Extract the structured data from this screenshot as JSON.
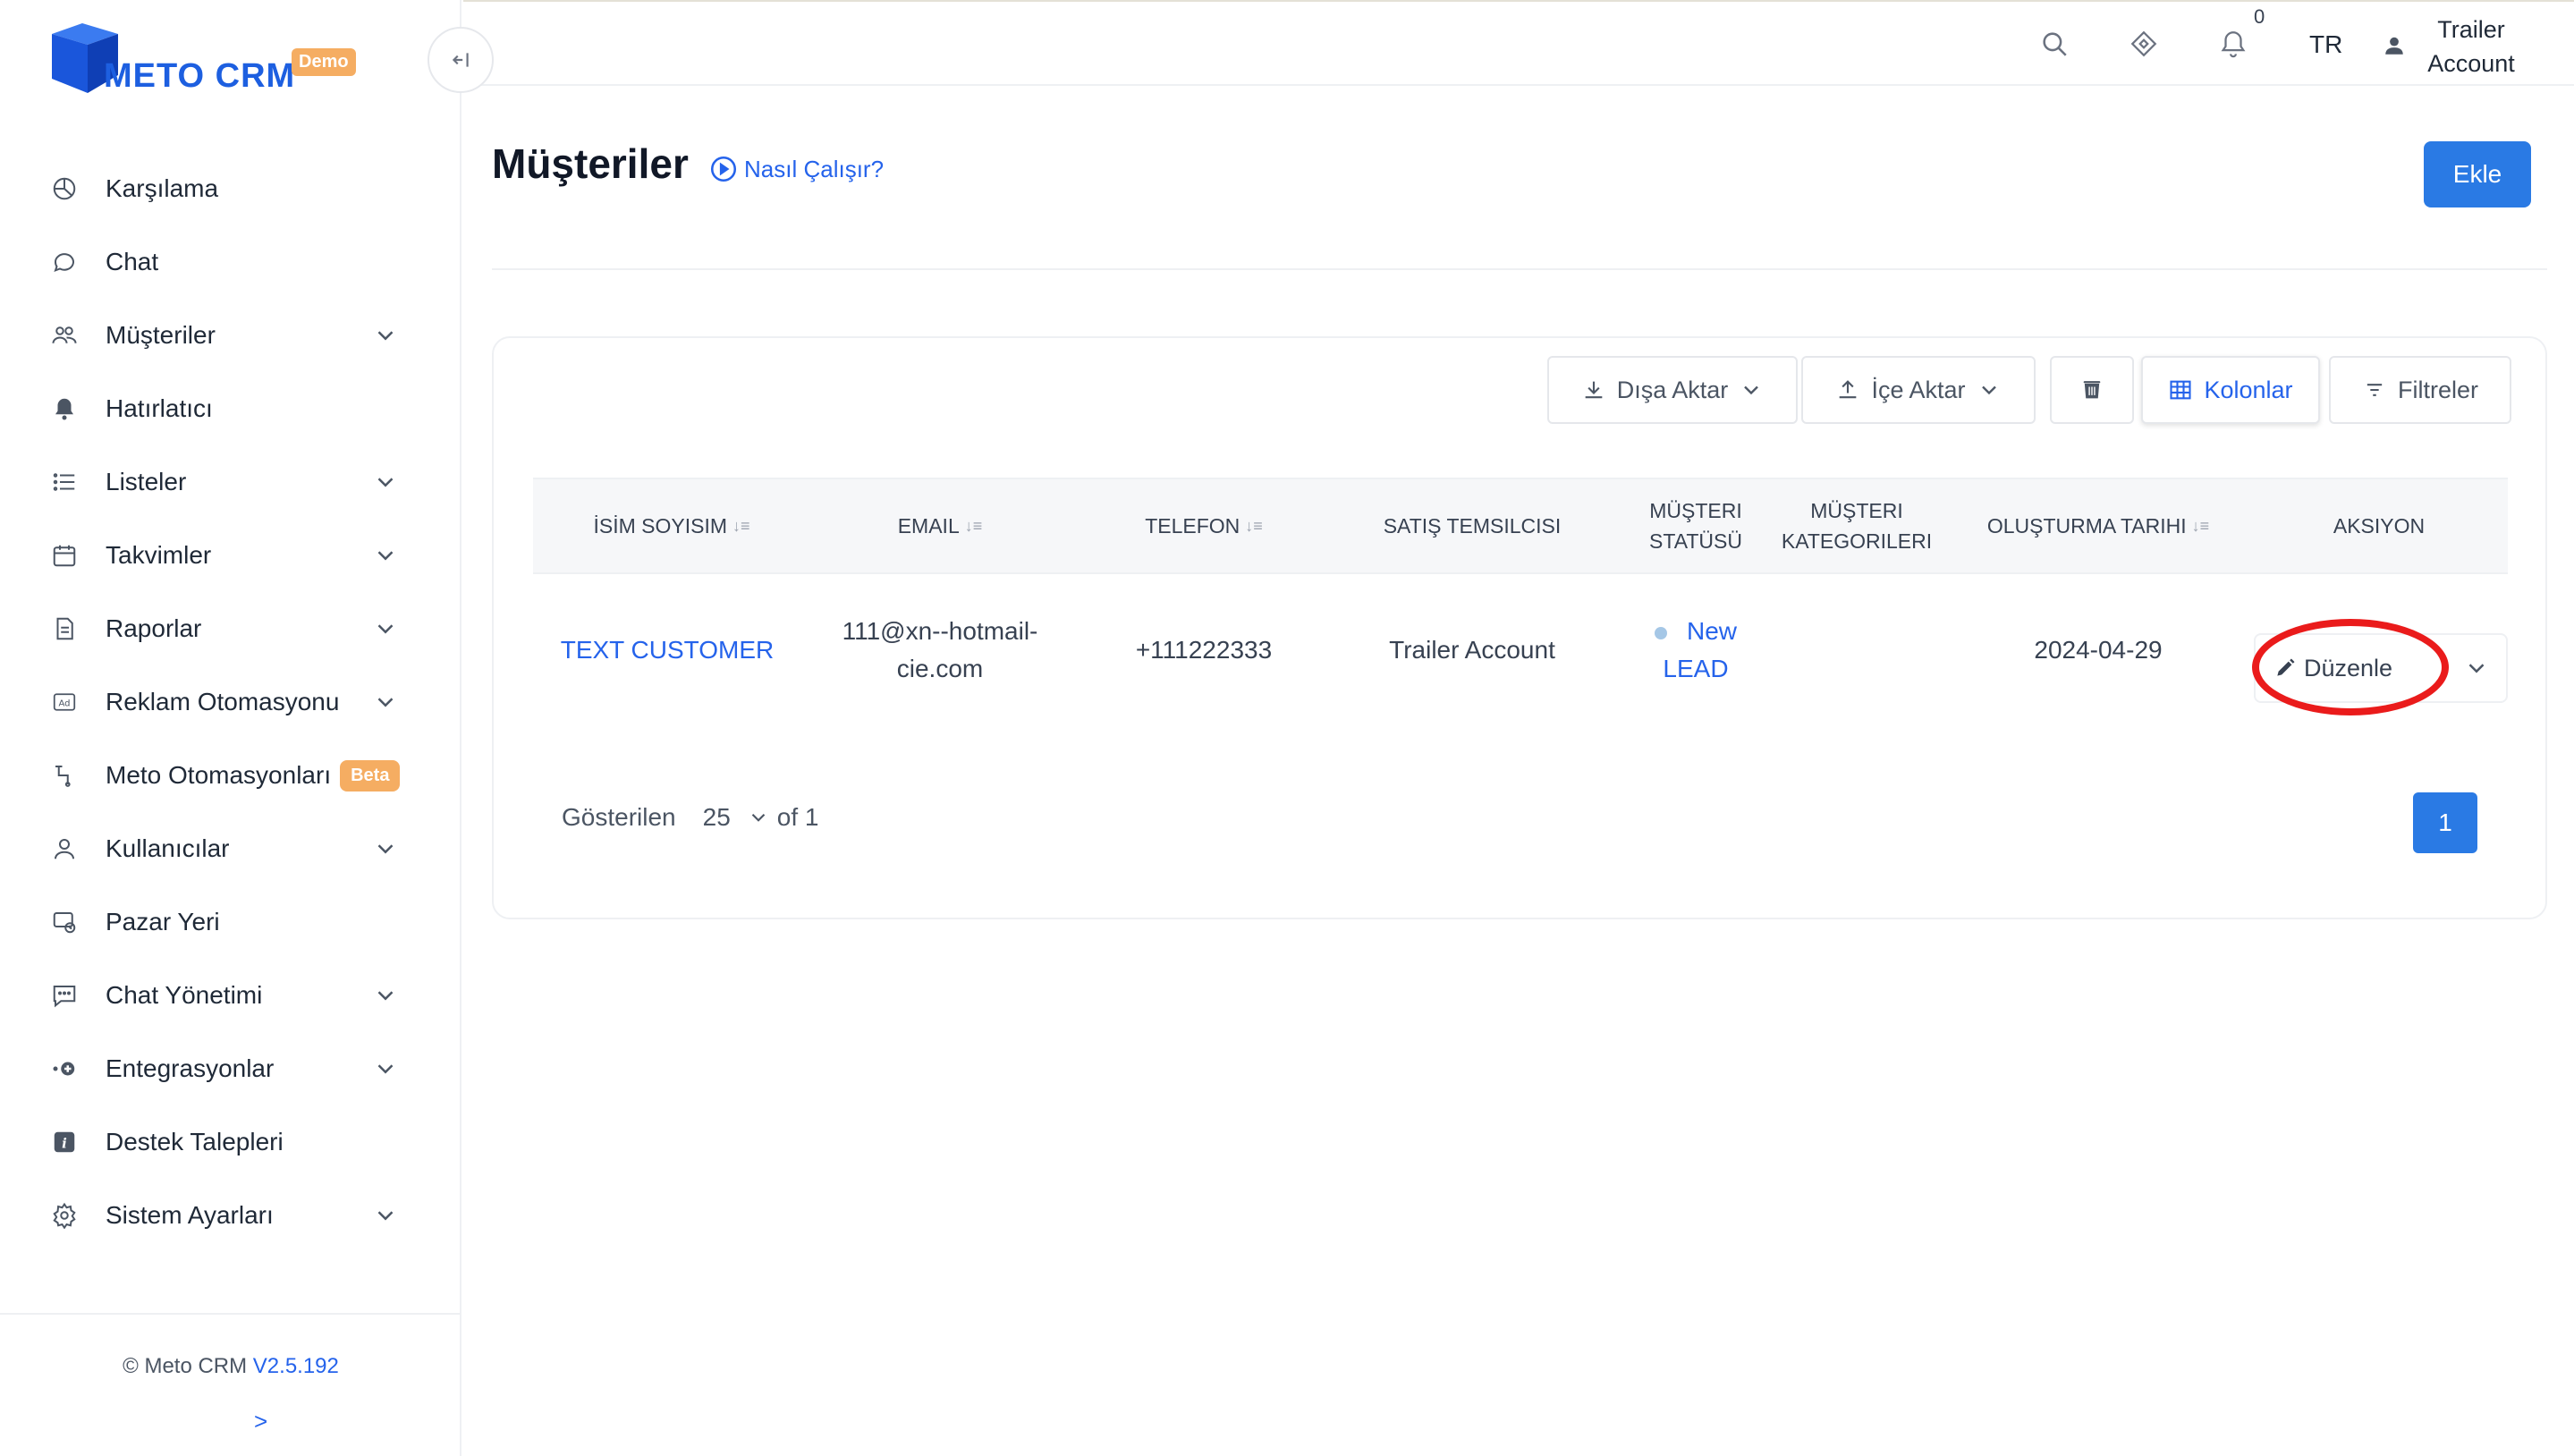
{
  "brand": {
    "name": "METO CRM",
    "badge": "Demo"
  },
  "sidebar": {
    "items": [
      {
        "label": "Karşılama",
        "icon": "dashboard-icon",
        "chevron": false
      },
      {
        "label": "Chat",
        "icon": "chat-icon",
        "chevron": false
      },
      {
        "label": "Müşteriler",
        "icon": "users-icon",
        "chevron": true
      },
      {
        "label": "Hatırlatıcı",
        "icon": "bell-icon",
        "chevron": false
      },
      {
        "label": "Listeler",
        "icon": "list-icon",
        "chevron": true
      },
      {
        "label": "Takvimler",
        "icon": "calendar-icon",
        "chevron": true
      },
      {
        "label": "Raporlar",
        "icon": "report-icon",
        "chevron": true
      },
      {
        "label": "Reklam Otomasyonu",
        "icon": "ad-icon",
        "chevron": true
      },
      {
        "label": "Meto Otomasyonları",
        "icon": "automation-icon",
        "chevron": false,
        "badge": "Beta"
      },
      {
        "label": "Kullanıcılar",
        "icon": "user-icon",
        "chevron": true
      },
      {
        "label": "Pazar Yeri",
        "icon": "marketplace-icon",
        "chevron": false
      },
      {
        "label": "Chat Yönetimi",
        "icon": "chat-settings-icon",
        "chevron": true
      },
      {
        "label": "Entegrasyonlar",
        "icon": "integration-icon",
        "chevron": true
      },
      {
        "label": "Destek Talepleri",
        "icon": "info-icon",
        "chevron": false
      },
      {
        "label": "Sistem Ayarları",
        "icon": "gear-icon",
        "chevron": true
      }
    ],
    "footer": {
      "copyright": "© Meto CRM",
      "version": "V2.5.192",
      "arrow": ">"
    }
  },
  "topbar": {
    "notification_count": "0",
    "language": "TR",
    "user": "Trailer Account"
  },
  "page": {
    "title": "Müşteriler",
    "howto": "Nasıl Çalışır?",
    "add_button": "Ekle"
  },
  "toolbar": {
    "export": "Dışa Aktar",
    "import": "İçe Aktar",
    "columns": "Kolonlar",
    "filters": "Filtreler"
  },
  "table": {
    "headers": [
      "İSİM SOYISIM",
      "EMAIL",
      "TELEFON",
      "SATIŞ TEMSILCISI",
      "MÜŞTERI STATÜSÜ",
      "MÜŞTERI KATEGORILERI",
      "OLUŞTURMA TARIHI",
      "AKSIYON"
    ],
    "rows": [
      {
        "name": "TEXT CUSTOMER",
        "email": "111@xn--hotmail-cie.com",
        "phone": "+111222333",
        "rep": "Trailer Account",
        "status": "New LEAD",
        "categories": "",
        "created": "2024-04-29",
        "action": "Düzenle"
      }
    ]
  },
  "pagination": {
    "shown_label": "Gösterilen",
    "page_size": "25",
    "of_label": "of 1",
    "current_page": "1"
  },
  "colors": {
    "accent": "#2a7ae4",
    "link": "#2563eb",
    "badge": "#f5ad62",
    "annotation": "#ea1b1b"
  }
}
